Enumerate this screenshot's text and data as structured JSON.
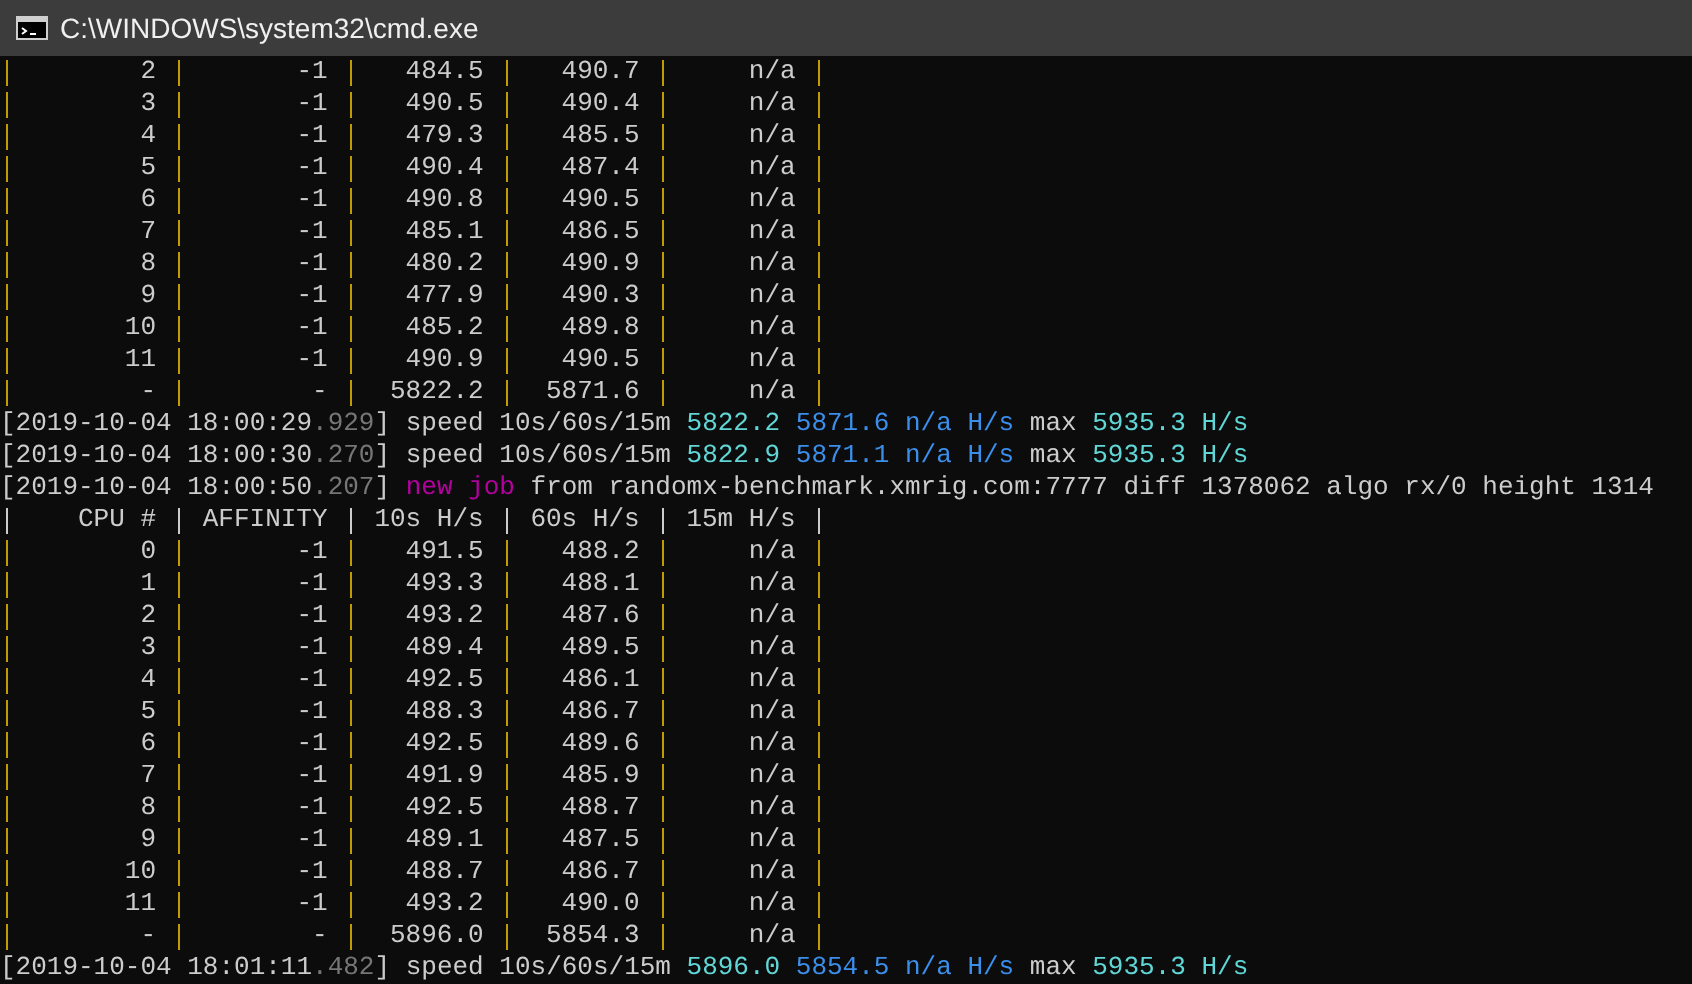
{
  "window": {
    "title": "C:\\WINDOWS\\system32\\cmd.exe"
  },
  "lines": [
    {
      "kind": "row",
      "cells": [
        "2",
        "-1",
        "484.5",
        "490.7",
        "n/a"
      ]
    },
    {
      "kind": "row",
      "cells": [
        "3",
        "-1",
        "490.5",
        "490.4",
        "n/a"
      ]
    },
    {
      "kind": "row",
      "cells": [
        "4",
        "-1",
        "479.3",
        "485.5",
        "n/a"
      ]
    },
    {
      "kind": "row",
      "cells": [
        "5",
        "-1",
        "490.4",
        "487.4",
        "n/a"
      ]
    },
    {
      "kind": "row",
      "cells": [
        "6",
        "-1",
        "490.8",
        "490.5",
        "n/a"
      ]
    },
    {
      "kind": "row",
      "cells": [
        "7",
        "-1",
        "485.1",
        "486.5",
        "n/a"
      ]
    },
    {
      "kind": "row",
      "cells": [
        "8",
        "-1",
        "480.2",
        "490.9",
        "n/a"
      ]
    },
    {
      "kind": "row",
      "cells": [
        "9",
        "-1",
        "477.9",
        "490.3",
        "n/a"
      ]
    },
    {
      "kind": "row",
      "cells": [
        "10",
        "-1",
        "485.2",
        "489.8",
        "n/a"
      ]
    },
    {
      "kind": "row",
      "cells": [
        "11",
        "-1",
        "490.9",
        "490.5",
        "n/a"
      ]
    },
    {
      "kind": "row",
      "cells": [
        "-",
        "-",
        "5822.2",
        "5871.6",
        "n/a"
      ]
    },
    {
      "kind": "speed",
      "time": "[2019-10-04 18:00:29",
      "ms": ".929",
      "label": "] speed 10s/60s/15m",
      "value_10s": "5822.2",
      "value_60s": "5871.6 n/a H/s",
      "max_label": "max",
      "max": "5935.3 H/s"
    },
    {
      "kind": "speed",
      "time": "[2019-10-04 18:00:30",
      "ms": ".270",
      "label": "] speed 10s/60s/15m",
      "value_10s": "5822.9",
      "value_60s": "5871.1 n/a H/s",
      "max_label": "max",
      "max": "5935.3 H/s"
    },
    {
      "kind": "job",
      "time": "[2019-10-04 18:00:50",
      "ms": ".207",
      "label": "]",
      "event": "new job",
      "text": "from randomx-benchmark.xmrig.com:7777 diff 1378062 algo rx/0 height 1314"
    },
    {
      "kind": "header",
      "cells": [
        "CPU #",
        "AFFINITY",
        "10s H/s",
        "60s H/s",
        "15m H/s"
      ]
    },
    {
      "kind": "row",
      "cells": [
        "0",
        "-1",
        "491.5",
        "488.2",
        "n/a"
      ]
    },
    {
      "kind": "row",
      "cells": [
        "1",
        "-1",
        "493.3",
        "488.1",
        "n/a"
      ]
    },
    {
      "kind": "row",
      "cells": [
        "2",
        "-1",
        "493.2",
        "487.6",
        "n/a"
      ]
    },
    {
      "kind": "row",
      "cells": [
        "3",
        "-1",
        "489.4",
        "489.5",
        "n/a"
      ]
    },
    {
      "kind": "row",
      "cells": [
        "4",
        "-1",
        "492.5",
        "486.1",
        "n/a"
      ]
    },
    {
      "kind": "row",
      "cells": [
        "5",
        "-1",
        "488.3",
        "486.7",
        "n/a"
      ]
    },
    {
      "kind": "row",
      "cells": [
        "6",
        "-1",
        "492.5",
        "489.6",
        "n/a"
      ]
    },
    {
      "kind": "row",
      "cells": [
        "7",
        "-1",
        "491.9",
        "485.9",
        "n/a"
      ]
    },
    {
      "kind": "row",
      "cells": [
        "8",
        "-1",
        "492.5",
        "488.7",
        "n/a"
      ]
    },
    {
      "kind": "row",
      "cells": [
        "9",
        "-1",
        "489.1",
        "487.5",
        "n/a"
      ]
    },
    {
      "kind": "row",
      "cells": [
        "10",
        "-1",
        "488.7",
        "486.7",
        "n/a"
      ]
    },
    {
      "kind": "row",
      "cells": [
        "11",
        "-1",
        "493.2",
        "490.0",
        "n/a"
      ]
    },
    {
      "kind": "row",
      "cells": [
        "-",
        "-",
        "5896.0",
        "5854.3",
        "n/a"
      ]
    },
    {
      "kind": "speed",
      "time": "[2019-10-04 18:01:11",
      "ms": ".482",
      "label": "] speed 10s/60s/15m",
      "value_10s": "5896.0",
      "value_60s": "5854.5 n/a H/s",
      "max_label": "max",
      "max": "5935.3 H/s"
    }
  ]
}
